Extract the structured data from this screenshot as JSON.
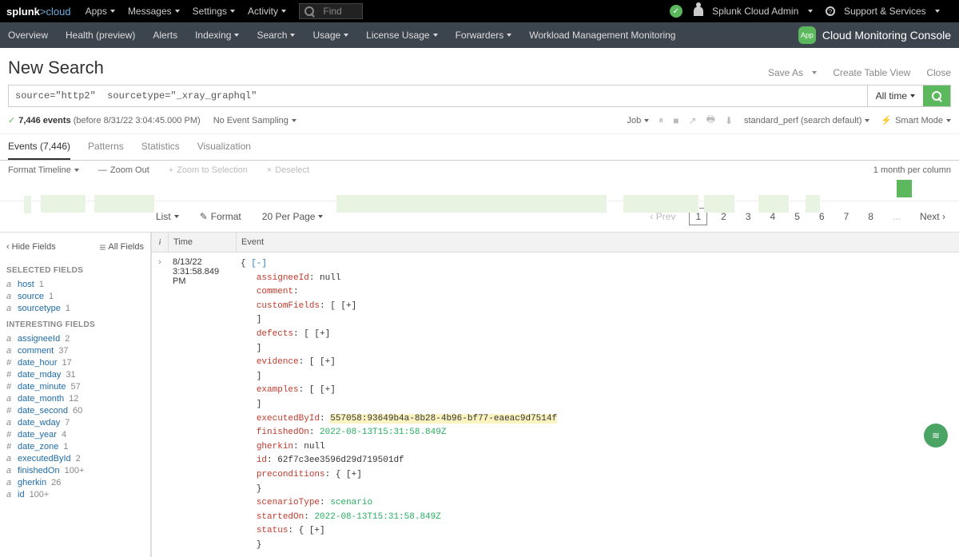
{
  "topbar": {
    "logo_main": "splunk",
    "logo_sub": ">cloud",
    "menu": [
      "Apps",
      "Messages",
      "Settings",
      "Activity"
    ],
    "search_placeholder": "Find",
    "admin": "Splunk Cloud Admin",
    "support": "Support & Services"
  },
  "navbar": {
    "items": [
      "Overview",
      "Health (preview)",
      "Alerts",
      "Indexing",
      "Search",
      "Usage",
      "License Usage",
      "Forwarders",
      "Workload Management Monitoring"
    ],
    "dropdown_flags": [
      false,
      false,
      false,
      true,
      true,
      true,
      true,
      true,
      false
    ],
    "brand_badge": "App",
    "brand": "Cloud Monitoring Console"
  },
  "page": {
    "title": "New Search",
    "actions": {
      "save_as": "Save As",
      "create_table": "Create Table View",
      "close": "Close"
    }
  },
  "search": {
    "query": "source=\"http2\"  sourcetype=\"_xray_graphql\"",
    "time": "All time"
  },
  "jobbar": {
    "count": "7,446 events",
    "range": "(before 8/31/22 3:04:45.000 PM)",
    "sampling": "No Event Sampling",
    "job": "Job",
    "mode_label": "standard_perf (search default)",
    "smart_mode": "Smart Mode"
  },
  "tabs": {
    "events": "Events (7,446)",
    "patterns": "Patterns",
    "statistics": "Statistics",
    "visualization": "Visualization"
  },
  "timeline_ctrl": {
    "format": "Format Timeline",
    "zoom_out": "Zoom Out",
    "zoom_sel": "Zoom to Selection",
    "deselect": "Deselect",
    "per_col": "1 month per column"
  },
  "list_ctrl": {
    "list": "List",
    "format": "Format",
    "per_page": "20 Per Page",
    "prev": "Prev",
    "next": "Next",
    "pages": [
      "1",
      "2",
      "3",
      "4",
      "5",
      "6",
      "7",
      "8",
      "...",
      "Next"
    ]
  },
  "sidebar": {
    "hide": "Hide Fields",
    "all": "All Fields",
    "selected_h": "SELECTED FIELDS",
    "interesting_h": "INTERESTING FIELDS",
    "selected": [
      {
        "t": "a",
        "n": "host",
        "c": "1"
      },
      {
        "t": "a",
        "n": "source",
        "c": "1"
      },
      {
        "t": "a",
        "n": "sourcetype",
        "c": "1"
      }
    ],
    "interesting": [
      {
        "t": "a",
        "n": "assigneeId",
        "c": "2"
      },
      {
        "t": "a",
        "n": "comment",
        "c": "37"
      },
      {
        "t": "#",
        "n": "date_hour",
        "c": "17"
      },
      {
        "t": "#",
        "n": "date_mday",
        "c": "31"
      },
      {
        "t": "#",
        "n": "date_minute",
        "c": "57"
      },
      {
        "t": "a",
        "n": "date_month",
        "c": "12"
      },
      {
        "t": "#",
        "n": "date_second",
        "c": "60"
      },
      {
        "t": "a",
        "n": "date_wday",
        "c": "7"
      },
      {
        "t": "#",
        "n": "date_year",
        "c": "4"
      },
      {
        "t": "#",
        "n": "date_zone",
        "c": "1"
      },
      {
        "t": "a",
        "n": "executedById",
        "c": "2"
      },
      {
        "t": "a",
        "n": "finishedOn",
        "c": "100+"
      },
      {
        "t": "a",
        "n": "gherkin",
        "c": "26"
      },
      {
        "t": "a",
        "n": "id",
        "c": "100+"
      }
    ]
  },
  "table": {
    "col_i": "i",
    "col_time": "Time",
    "col_event": "Event",
    "row_date": "8/13/22",
    "row_time": "3:31:58.849 PM",
    "event": {
      "assigneeId": "null",
      "comment": "",
      "customFields_open": "[ [+]",
      "defects_open": "[ [+]",
      "evidence_open": "[ [+]",
      "examples_open": "[ [+]",
      "executedById": "557058:93649b4a-8b28-4b96-bf77-eaeac9d7514f",
      "finishedOn": "2022-08-13T15:31:58.849Z",
      "gherkin": "null",
      "id": "62f7c3ee3596d29d719501df",
      "preconditions_open": "{ [+]",
      "scenarioType": "scenario",
      "startedOn": "2022-08-13T15:31:58.849Z",
      "status_open": "{ [+]"
    }
  }
}
